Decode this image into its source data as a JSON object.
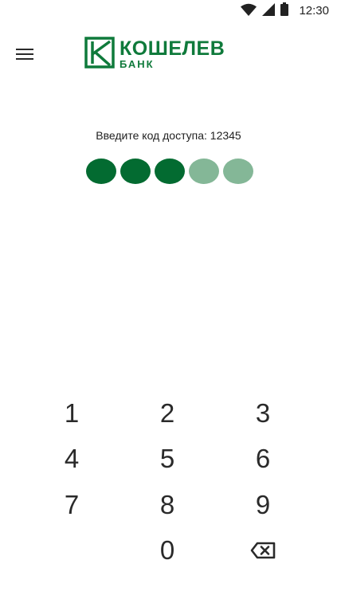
{
  "status_bar": {
    "time": "12:30",
    "icons": [
      "wifi-icon",
      "signal-icon",
      "battery-icon"
    ]
  },
  "header": {
    "menu_icon": "hamburger-menu-icon",
    "logo": {
      "name": "КОШЕЛЕВ",
      "sub": "БАНК",
      "color": "#0f7a3b"
    }
  },
  "pin": {
    "prompt": "Введите код доступа: 12345",
    "length": 5,
    "entered": 3,
    "filled_color": "#036b31",
    "empty_color": "#84b797"
  },
  "keypad": {
    "keys": [
      "1",
      "2",
      "3",
      "4",
      "5",
      "6",
      "7",
      "8",
      "9",
      "",
      "0"
    ],
    "backspace_icon": "backspace-icon"
  }
}
